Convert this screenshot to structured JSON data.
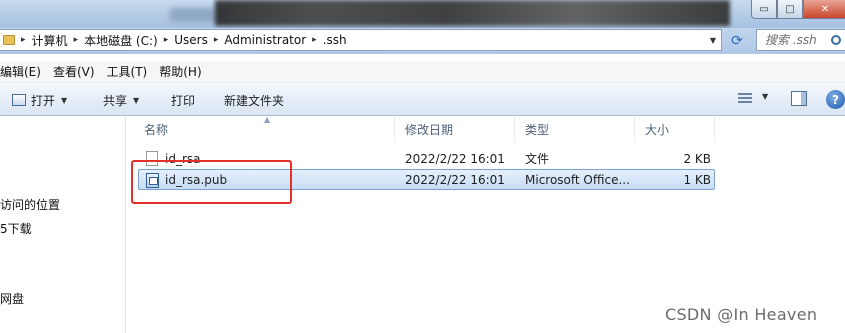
{
  "address_bar": {
    "breadcrumbs": [
      "计算机",
      "本地磁盘 (C:)",
      "Users",
      "Administrator",
      ".ssh"
    ],
    "search_placeholder": "搜索 .ssh"
  },
  "window_controls": {
    "minimize": "▭",
    "maximize": "□",
    "close": "✕"
  },
  "menubar": {
    "items": [
      "编辑(E)",
      "查看(V)",
      "工具(T)",
      "帮助(H)"
    ]
  },
  "toolbar": {
    "open_label": "打开",
    "share_label": "共享",
    "print_label": "打印",
    "new_folder_label": "新建文件夹",
    "help_label": "?"
  },
  "nav_pane": {
    "items": [
      "访问的位置",
      "5下载",
      "网盘"
    ]
  },
  "file_list": {
    "columns": {
      "name": "名称",
      "modified": "修改日期",
      "type": "类型",
      "size": "大小"
    },
    "rows": [
      {
        "name": "id_rsa",
        "modified": "2022/2/22 16:01",
        "type": "文件",
        "size": "2 KB",
        "icon": "blank-file-icon"
      },
      {
        "name": "id_rsa.pub",
        "modified": "2022/2/22 16:01",
        "type": "Microsoft Office...",
        "size": "1 KB",
        "icon": "publisher-file-icon",
        "selected": true
      }
    ]
  },
  "watermark": "CSDN @In  Heaven",
  "colors": {
    "highlight_border": "#e3302a",
    "selection": "#c7dcf5"
  }
}
